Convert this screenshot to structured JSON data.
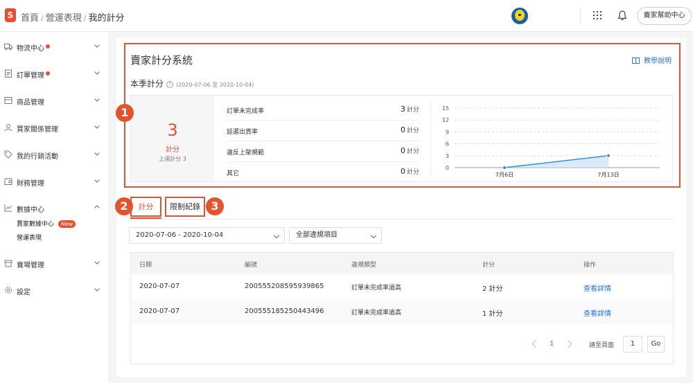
{
  "header": {
    "logo_letter": "S",
    "breadcrumb": [
      "首頁",
      "營運表現",
      "我的計分"
    ],
    "help_button": "賣家幫助中心"
  },
  "sidebar": {
    "items": [
      {
        "label": "物流中心",
        "icon": "truck-icon",
        "dot": true,
        "expanded": false
      },
      {
        "label": "訂單管理",
        "icon": "clipboard-icon",
        "dot": true,
        "expanded": false
      },
      {
        "label": "商品管理",
        "icon": "package-icon",
        "dot": false,
        "expanded": false
      },
      {
        "label": "買家關係管理",
        "icon": "user-icon",
        "dot": false,
        "expanded": false
      },
      {
        "label": "我的行銷活動",
        "icon": "tag-icon",
        "dot": false,
        "expanded": false
      },
      {
        "label": "財務管理",
        "icon": "wallet-icon",
        "dot": false,
        "expanded": false
      },
      {
        "label": "數據中心",
        "icon": "chart-line-icon",
        "dot": false,
        "expanded": true
      },
      {
        "label": "賣場管理",
        "icon": "store-icon",
        "dot": false,
        "expanded": false
      },
      {
        "label": "設定",
        "icon": "gear-icon",
        "dot": false,
        "expanded": false
      }
    ],
    "data_center_subitems": [
      {
        "label": "賣家數據中心",
        "badge": "New"
      },
      {
        "label": "營運表現"
      }
    ]
  },
  "main": {
    "title": "賣家計分系統",
    "guide_link": "教學說明",
    "season_label": "本季計分",
    "season_range": "(2020-07-06 至 2020-10-04)",
    "score": "3",
    "score_unit": "計分",
    "last_week": "上週計分 3",
    "metrics": [
      {
        "label": "訂單未完成率",
        "value": "3",
        "unit": "計分"
      },
      {
        "label": "延遲出貨率",
        "value": "0",
        "unit": "計分"
      },
      {
        "label": "違反上架規範",
        "value": "0",
        "unit": "計分"
      },
      {
        "label": "其它",
        "value": "0",
        "unit": "計分"
      }
    ],
    "tabs": [
      "計分",
      "限制紀錄"
    ],
    "active_tab": "計分",
    "annotation_badges": [
      "1",
      "2",
      "3"
    ],
    "filters": {
      "date_range": "2020-07-06 - 2020-10-04",
      "violation_type": "全部違規項目"
    },
    "table": {
      "headers": [
        "日期",
        "編號",
        "違規類型",
        "計分",
        "操作"
      ],
      "rows": [
        {
          "date": "2020-07-07",
          "id": "200555208595939865",
          "type": "訂單未完成率過高",
          "points": "2 計分",
          "action": "查看詳情"
        },
        {
          "date": "2020-07-07",
          "id": "200555185250443496",
          "type": "訂單未完成率過高",
          "points": "1 計分",
          "action": "查看詳情"
        }
      ]
    },
    "pagination": {
      "current_page": "1",
      "goto_label": "請至頁面",
      "goto_value": "1",
      "go_button": "Go"
    }
  },
  "chart_data": {
    "type": "area",
    "categories": [
      "7月6日",
      "7月13日"
    ],
    "values": [
      0,
      3
    ],
    "yticks": [
      0,
      3,
      6,
      9,
      12,
      15
    ],
    "ylim": [
      0,
      15
    ],
    "grid": true,
    "color": "#2f8fdf"
  },
  "colors": {
    "brand": "#ee4d2d",
    "annotation": "#e4532e",
    "link": "#2673dd"
  }
}
